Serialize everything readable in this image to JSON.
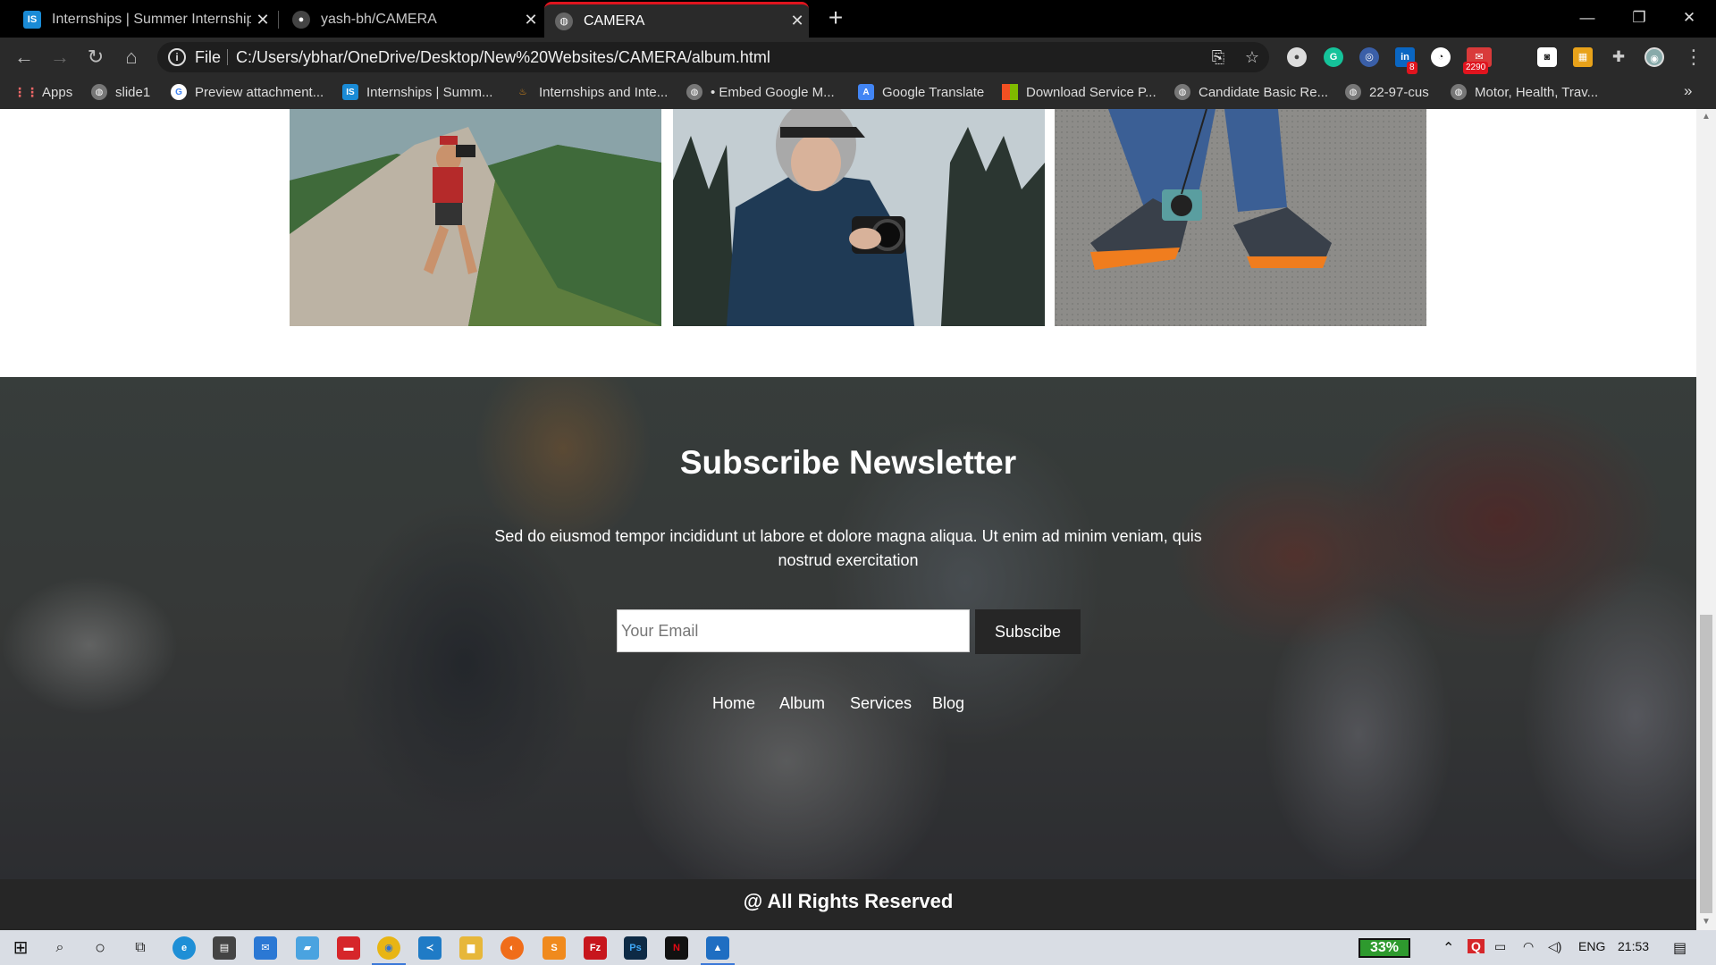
{
  "browser": {
    "tabs": [
      {
        "title": "Internships | Summer Internship",
        "favicon": "IS"
      },
      {
        "title": "yash-bh/CAMERA",
        "favicon": "github-icon"
      },
      {
        "title": "CAMERA",
        "favicon": "globe-icon"
      }
    ],
    "address": {
      "scheme": "File",
      "url": "C:/Users/ybhar/OneDrive/Desktop/New%20Websites/CAMERA/album.html"
    },
    "extensions": {
      "linkedin_badge": "8",
      "mail_badge": "2290"
    },
    "bookmarks": [
      {
        "label": "Apps"
      },
      {
        "label": "slide1"
      },
      {
        "label": "Preview attachment..."
      },
      {
        "label": "Internships | Summ..."
      },
      {
        "label": "Internships and Inte..."
      },
      {
        "label": "• Embed Google M..."
      },
      {
        "label": "Google Translate"
      },
      {
        "label": "Download Service P..."
      },
      {
        "label": "Candidate Basic Re..."
      },
      {
        "label": "22-97-cus"
      },
      {
        "label": "Motor, Health, Trav..."
      }
    ],
    "more_bookmarks": "»"
  },
  "page": {
    "newsletter": {
      "title": "Subscribe Newsletter",
      "text": "Sed do eiusmod tempor incididunt ut labore et dolore magna aliqua. Ut enim ad minim veniam, quis nostrud exercitation",
      "email_placeholder": "Your Email",
      "button_label": "Subscibe"
    },
    "footer_nav": [
      "Home",
      "Album",
      "Services",
      "Blog"
    ],
    "footer_text": "@ All Rights Reserved"
  },
  "taskbar": {
    "battery": "33%",
    "language": "ENG",
    "time": "21:53"
  },
  "colors": {
    "browser_bg": "#000000",
    "toolbar_bg": "#2a2a2a",
    "active_tab_accent": "#e0141e",
    "footer_bg": "#262626",
    "button_bg": "#262626",
    "taskbar_bg": "#d9dde4",
    "battery_green": "#2e9a2e"
  }
}
